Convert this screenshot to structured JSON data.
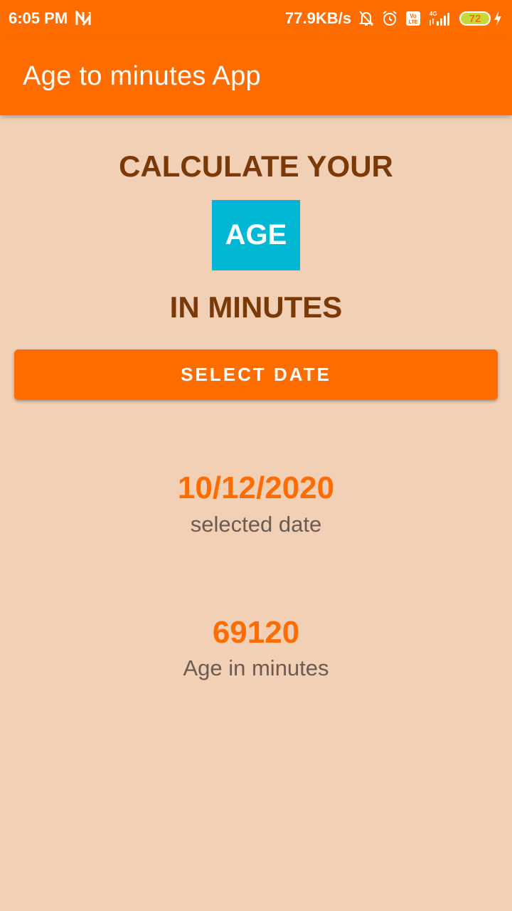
{
  "status_bar": {
    "time": "6:05 PM",
    "network_speed": "77.9KB/s",
    "network_type": "4G",
    "volte": "Vo LTE",
    "battery_level": "72",
    "icons": [
      "notification-n-icon",
      "bell-off-icon",
      "alarm-icon",
      "volte-icon",
      "signal-icon",
      "battery-icon",
      "charging-icon"
    ]
  },
  "app_bar": {
    "title": "Age to minutes App",
    "color": "#ff6d00"
  },
  "main": {
    "heading_top": "CALCULATE YOUR",
    "heading_highlight": "AGE",
    "heading_bottom": "IN MINUTES",
    "select_button_label": "SELECT DATE",
    "selected_date_value": "10/12/2020",
    "selected_date_caption": "selected date",
    "age_minutes_value": "69120",
    "age_minutes_caption": "Age in minutes"
  },
  "colors": {
    "accent": "#ff6d00",
    "background": "#f1d0b5",
    "heading": "#7b3908",
    "highlight_box": "#00b8d4",
    "caption": "#6b5b52"
  }
}
